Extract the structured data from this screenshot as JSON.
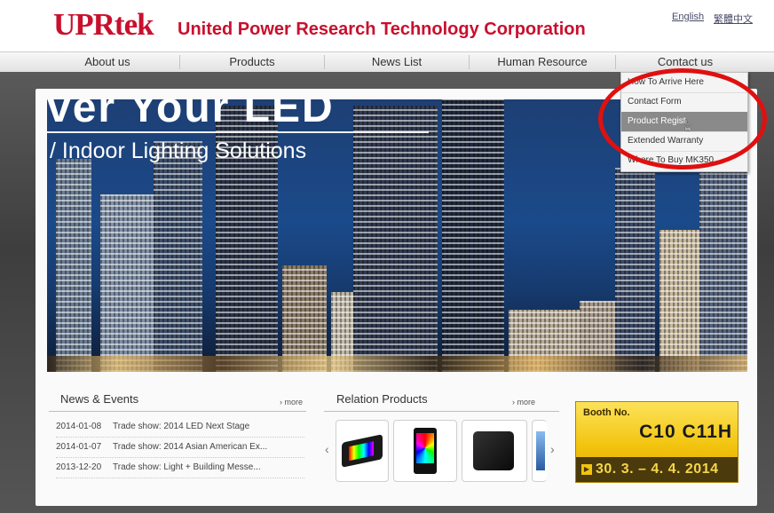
{
  "header": {
    "logo": "UPRtek",
    "company_name": "United Power Research Technology Corporation",
    "lang_en": "English",
    "lang_tw": "繁體中文"
  },
  "nav": {
    "items": [
      "About us",
      "Products",
      "News List",
      "Human Resource",
      "Contact us"
    ]
  },
  "dropdown": {
    "items": [
      "How To Arrive Here",
      "Contact Form",
      "Product Regist",
      "Extended Warranty",
      "Where To Buy MK350"
    ],
    "active_index": 2
  },
  "banner": {
    "headline": "ver Your LED",
    "subtitle": "/ Indoor Lighting Solutions"
  },
  "news": {
    "title": "News & Events",
    "more": "› more",
    "items": [
      {
        "date": "2014-01-08",
        "text": "Trade show: 2014 LED Next Stage"
      },
      {
        "date": "2014-01-07",
        "text": "Trade show: 2014 Asian American Ex..."
      },
      {
        "date": "2013-12-20",
        "text": "Trade show: Light + Building Messe..."
      }
    ]
  },
  "products": {
    "title": "Relation Products",
    "more": "› more",
    "prev": "‹",
    "next": "›"
  },
  "booth": {
    "label": "Booth No.",
    "numbers": "C10 C11H",
    "dates": "30. 3. –  4. 4. 2014",
    "play": "▶"
  },
  "colors": {
    "brand_red": "#c8102e",
    "highlight_circle": "#e01010",
    "booth_yellow": "#f2c40f"
  }
}
